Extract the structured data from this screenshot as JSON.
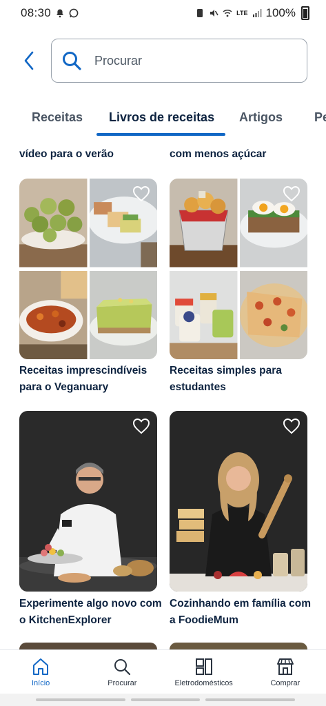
{
  "status_bar": {
    "time": "08:30",
    "battery": "100%",
    "network": "LTE"
  },
  "search": {
    "placeholder": "Procurar"
  },
  "tabs": [
    {
      "label": "Receitas"
    },
    {
      "label": "Livros de receitas",
      "active": true
    },
    {
      "label": "Artigos"
    },
    {
      "label": "Pe"
    }
  ],
  "cards": {
    "top_left_title": "vídeo para o verão",
    "top_right_title": "com menos açúcar",
    "veganuary_title": "Receitas imprescindíveis para o Veganuary",
    "students_title": "Receitas simples para estudantes",
    "kitchen_title": "Experimente algo novo com o KitchenExplorer",
    "foodie_title": "Cozinhando em família com a FoodieMum"
  },
  "bottom_nav": [
    {
      "label": "Início",
      "icon": "home-icon",
      "active": true
    },
    {
      "label": "Procurar",
      "icon": "search-icon"
    },
    {
      "label": "Eletrodomésticos",
      "icon": "appliances-icon"
    },
    {
      "label": "Comprar",
      "icon": "shop-icon"
    }
  ],
  "colors": {
    "accent": "#1167c5",
    "text": "#0d2340"
  }
}
